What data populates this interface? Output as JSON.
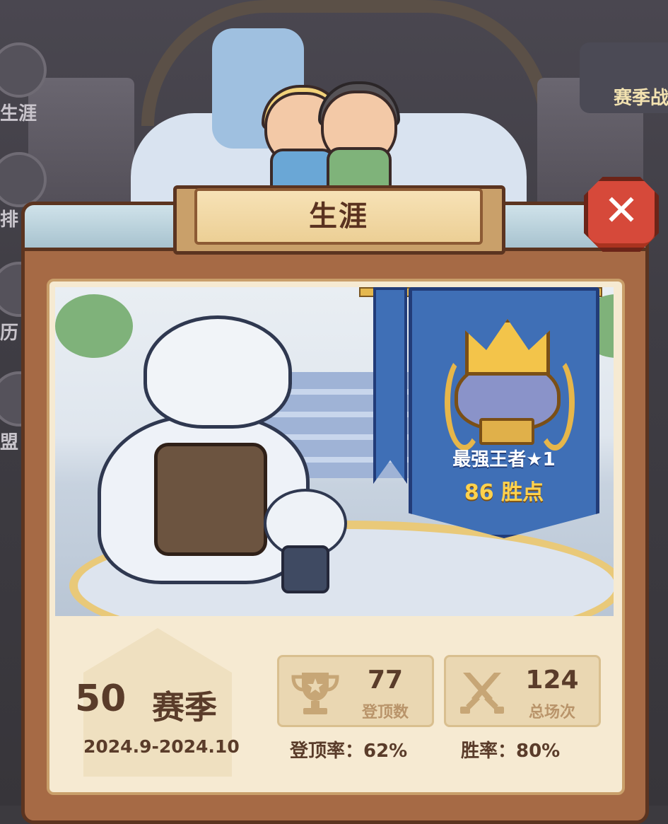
{
  "background": {
    "side_labels": [
      "生涯",
      "排",
      "历",
      "盟"
    ],
    "season_button_label": "赛季战"
  },
  "panel": {
    "title": "生涯",
    "close_symbol": "✕"
  },
  "rank": {
    "name": "最强王者★1",
    "points_value": "86",
    "points_unit": "胜点"
  },
  "season": {
    "number": "50",
    "word": "赛季",
    "date_range": "2024.9-2024.10"
  },
  "stats": {
    "top_count": "77",
    "top_count_label": "登顶数",
    "total_games": "124",
    "total_games_label": "总场次",
    "top_rate_label": "登顶率：62%",
    "win_rate_label": "胜率：80%"
  },
  "colors": {
    "panel_brown": "#a66a45",
    "banner_blue": "#3f6fb6",
    "close_red": "#d6493a",
    "gold": "#ffd24d"
  }
}
